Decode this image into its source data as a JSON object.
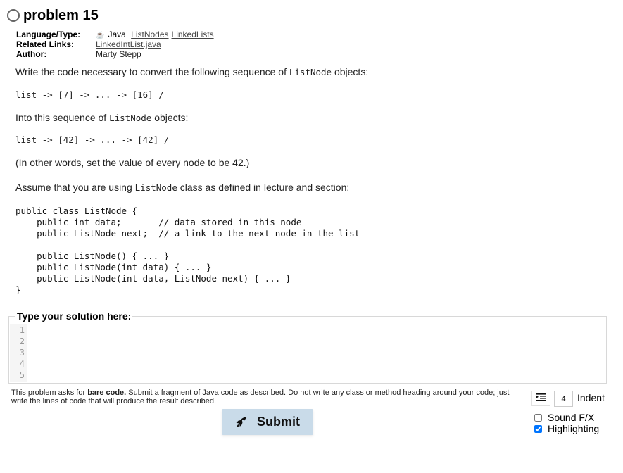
{
  "problem": {
    "title": "problem 15",
    "status_icon": "empty-circle-icon"
  },
  "meta": {
    "language_label": "Language/Type:",
    "language_icon": "java-icon",
    "language": "Java",
    "tags": [
      "ListNodes",
      "LinkedLists"
    ],
    "related_label": "Related Links:",
    "related_links": [
      "LinkedIntList.java"
    ],
    "author_label": "Author:",
    "author": "Marty Stepp"
  },
  "description": {
    "intro_before": "Write the code necessary to convert the following sequence of ",
    "intro_code": "ListNode",
    "intro_after": " objects:",
    "before_seq": "list -> [7] -> ... -> [16] /",
    "into_before": "Into this sequence of ",
    "into_code": "ListNode",
    "into_after": " objects:",
    "after_seq": "list -> [42] -> ... -> [42] /",
    "note": "(In other words, set the value of every node to be 42.)",
    "assume_before": "Assume that you are using ",
    "assume_code": "ListNode",
    "assume_after": " class as defined in lecture and section:",
    "class_code": "public class ListNode {\n    public int data;       // data stored in this node\n    public ListNode next;  // a link to the next node in the list\n\n    public ListNode() { ... }\n    public ListNode(int data) { ... }\n    public ListNode(int data, ListNode next) { ... }\n}"
  },
  "solution": {
    "legend": "Type your solution here:",
    "line_numbers": [
      "1",
      "2",
      "3",
      "4",
      "5"
    ],
    "value": ""
  },
  "instructions": {
    "before": "This problem asks for ",
    "bold": "bare code.",
    "after": " Submit a fragment of Java code as described. Do not write any class or method heading around your code; just write the lines of code that will produce the result described."
  },
  "submit": {
    "label": "Submit",
    "icon": "rocket-icon"
  },
  "controls": {
    "indent_icon": "indent-icon",
    "indent_value": "4",
    "indent_label": "Indent",
    "sound_label": "Sound F/X",
    "sound_checked": false,
    "highlighting_label": "Highlighting",
    "highlighting_checked": true
  },
  "colors": {
    "submit_bg": "#c9dbe9",
    "checkbox_accent": "#1a73e8"
  }
}
